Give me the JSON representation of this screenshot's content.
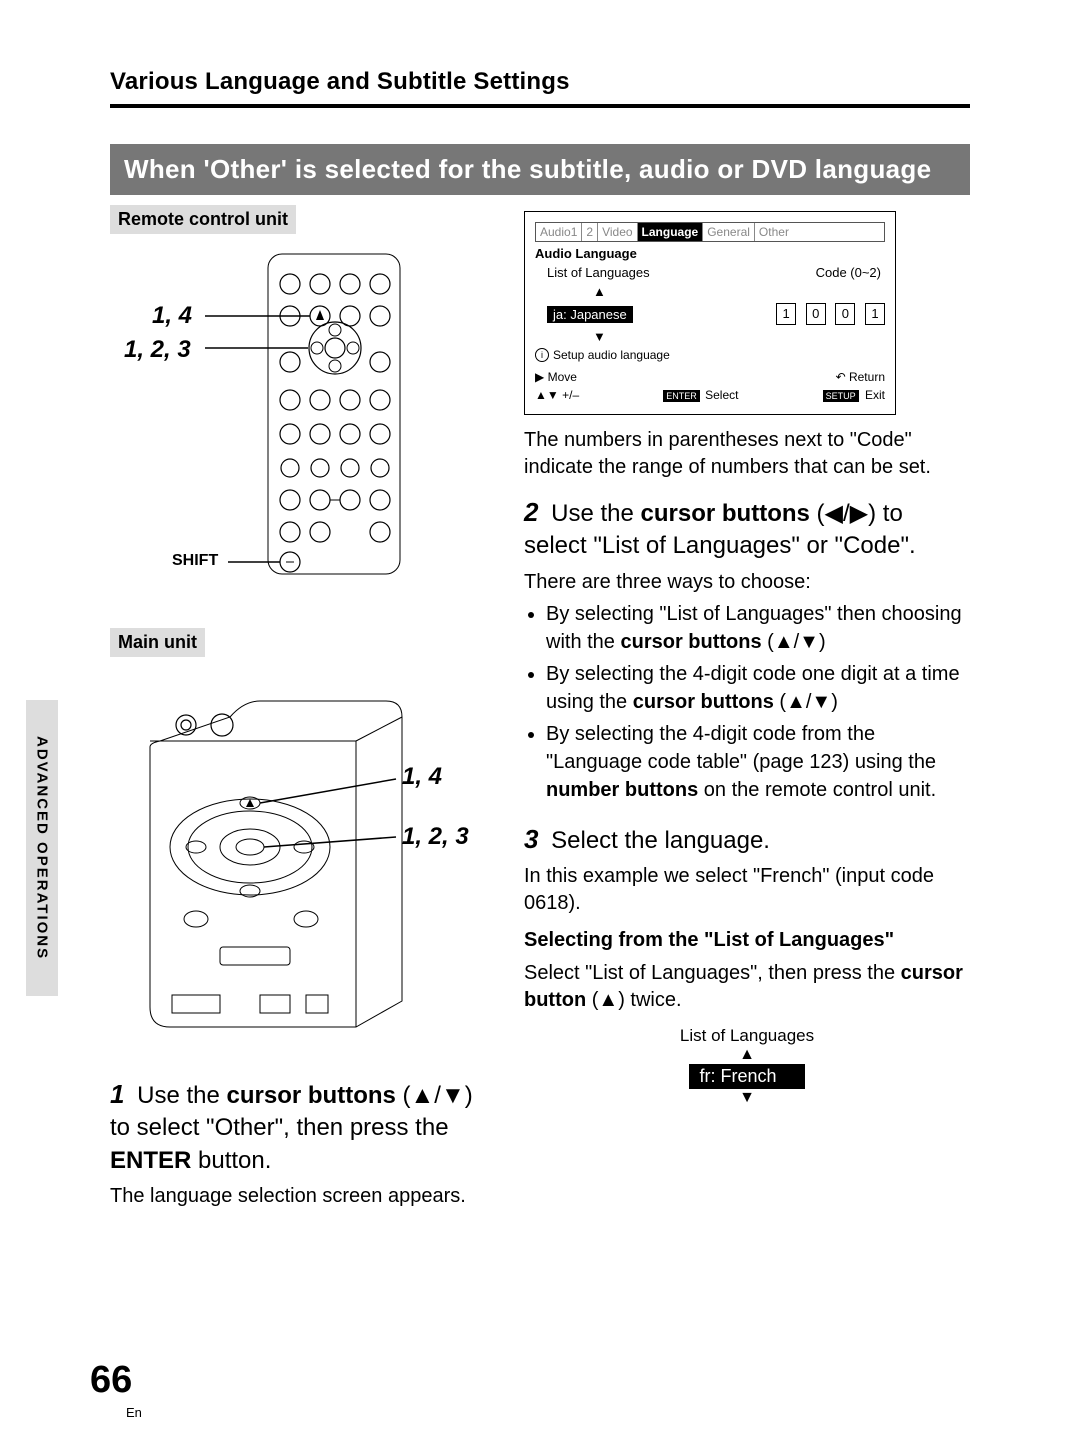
{
  "header": {
    "section_title": "Various Language and Subtitle Settings",
    "bar_title": "When 'Other' is selected for the subtitle, audio or DVD language"
  },
  "side_tab": "ADVANCED OPERATIONS",
  "page_number": "66",
  "page_lang": "En",
  "left": {
    "remote_label": "Remote control unit",
    "main_label": "Main unit",
    "callout_14": "1, 4",
    "callout_123": "1, 2, 3",
    "shift_label": "SHIFT"
  },
  "osd": {
    "tabs": [
      "Audio1",
      "2",
      "Video",
      "Language",
      "General",
      "Other"
    ],
    "active_tab": "Language",
    "heading": "Audio Language",
    "list_label": "List of Languages",
    "code_label": "Code (0~2)",
    "selected_lang": "ja: Japanese",
    "code_digits": [
      "1",
      "0",
      "0",
      "1"
    ],
    "info_line": "Setup audio language",
    "move": "Move",
    "plus_minus": "+/–",
    "enter": "ENTER",
    "select": "Select",
    "return": "Return",
    "setup": "SETUP",
    "exit": "Exit"
  },
  "steps": {
    "s1_head_a": "Use the ",
    "s1_head_bold1": "cursor buttons",
    "s1_head_b": " (▲/▼) to select \"Other\", then press the ",
    "s1_head_bold2": "ENTER",
    "s1_head_c": " button.",
    "s1_body": "The language selection screen appears.",
    "post_osd": "The numbers in parentheses next to \"Code\" indicate the range of numbers that can be set.",
    "s2_head_a": "Use the ",
    "s2_head_bold": "cursor buttons",
    "s2_head_b": " (◀/▶) to select \"List of Languages\" or \"Code\".",
    "s2_body": "There are three ways to choose:",
    "s2_b1a": "By selecting \"List of Languages\" then choosing with the ",
    "s2_b1b": "cursor buttons",
    "s2_b1c": " (▲/▼)",
    "s2_b2a": "By selecting the 4-digit code one digit at a time using the ",
    "s2_b2b": "cursor buttons",
    "s2_b2c": " (▲/▼)",
    "s2_b3a": "By selecting the 4-digit code from the \"Language code table\" (page 123) using the ",
    "s2_b3b": "number buttons",
    "s2_b3c": " on the remote control unit.",
    "s3_head": "Select the language.",
    "s3_body": "In this example we select \"French\" (input code 0618).",
    "s3_sub": "Selecting from the \"List of Languages\"",
    "s3_body2a": "Select \"List of Languages\", then press the ",
    "s3_body2b": "cursor button",
    "s3_body2c": " (▲) twice.",
    "lang_list_caption": "List of Languages",
    "lang_list_value": "fr: French"
  }
}
